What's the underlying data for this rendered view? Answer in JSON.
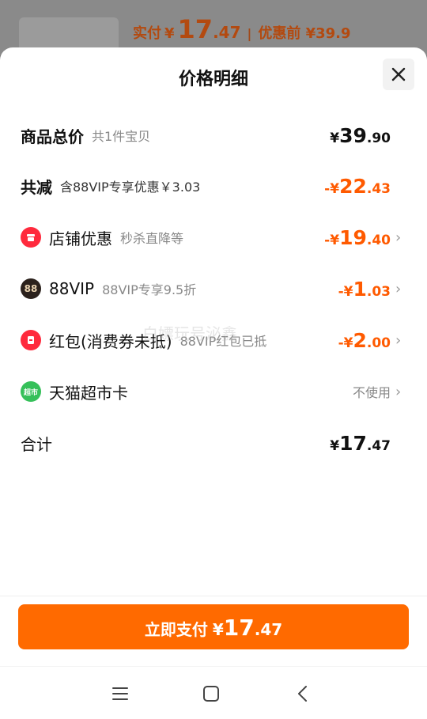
{
  "background": {
    "paid_label": "实付",
    "paid_currency": "¥",
    "paid_integer": "17",
    "paid_decimal": ".47",
    "separator": "|",
    "before_discount": "优惠前 ¥39.9"
  },
  "sheet": {
    "title": "价格明细",
    "close_icon": "close-icon"
  },
  "rows": {
    "total": {
      "label": "商品总价",
      "sub": "共1件宝贝",
      "currency": "¥",
      "int": "39",
      "dec": ".90"
    },
    "discount": {
      "label": "共减",
      "sub": "含88VIP专享优惠￥3.03",
      "sign": "-",
      "currency": "¥",
      "int": "22",
      "dec": ".43"
    },
    "store": {
      "label": "店铺优惠",
      "sub": "秒杀直降等",
      "sign": "-",
      "currency": "¥",
      "int": "19",
      "dec": ".40",
      "icon": "store-icon",
      "icon_color": "#ff2a3d"
    },
    "vip": {
      "label": "88VIP",
      "sub": "88VIP专享9.5折",
      "sign": "-",
      "currency": "¥",
      "int": "1",
      "dec": ".03",
      "icon_text": "88",
      "icon_color": "#2b211c"
    },
    "redpacket": {
      "label": "红包(消费券未抵)",
      "sub": "88VIP红包已抵",
      "sign": "-",
      "currency": "¥",
      "int": "2",
      "dec": ".00",
      "icon": "red-packet-icon",
      "icon_color": "#ff2a3d"
    },
    "tmall": {
      "label": "天猫超市卡",
      "value": "不使用",
      "icon_text": "超市",
      "icon_color": "#36c05a"
    },
    "sum": {
      "label": "合计",
      "currency": "¥",
      "int": "17",
      "dec": ".47"
    }
  },
  "watermark": "白嫖玩号泌鑫",
  "pay_button": {
    "label": "立即支付",
    "currency": "¥",
    "int": "17",
    "dec": ".47"
  },
  "colors": {
    "accent": "#ff6a00",
    "discount_text": "#ff5a00"
  }
}
